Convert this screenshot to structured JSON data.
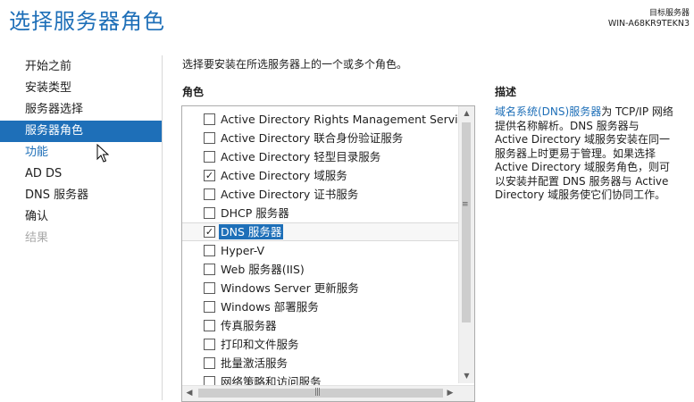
{
  "page": {
    "title": "选择服务器角色",
    "target_label": "目标服务器",
    "target_server": "WIN-A68KR9TEKN3",
    "instruction": "选择要安装在所选服务器上的一个或多个角色。",
    "roles_heading": "角色",
    "description_heading": "描述"
  },
  "nav": {
    "items": [
      {
        "label": "开始之前",
        "state": "normal"
      },
      {
        "label": "安装类型",
        "state": "normal"
      },
      {
        "label": "服务器选择",
        "state": "normal"
      },
      {
        "label": "服务器角色",
        "state": "current"
      },
      {
        "label": "功能",
        "state": "link"
      },
      {
        "label": "AD DS",
        "state": "normal"
      },
      {
        "label": "DNS 服务器",
        "state": "normal"
      },
      {
        "label": "确认",
        "state": "normal"
      },
      {
        "label": "结果",
        "state": "disabled"
      }
    ]
  },
  "roles": [
    {
      "label": "Active Directory Rights Management Services",
      "checked": false,
      "selected": false
    },
    {
      "label": "Active Directory 联合身份验证服务",
      "checked": false,
      "selected": false
    },
    {
      "label": "Active Directory 轻型目录服务",
      "checked": false,
      "selected": false
    },
    {
      "label": "Active Directory 域服务",
      "checked": true,
      "selected": false
    },
    {
      "label": "Active Directory 证书服务",
      "checked": false,
      "selected": false
    },
    {
      "label": "DHCP 服务器",
      "checked": false,
      "selected": false
    },
    {
      "label": "DNS 服务器",
      "checked": true,
      "selected": true
    },
    {
      "label": "Hyper-V",
      "checked": false,
      "selected": false
    },
    {
      "label": "Web 服务器(IIS)",
      "checked": false,
      "selected": false
    },
    {
      "label": "Windows Server 更新服务",
      "checked": false,
      "selected": false
    },
    {
      "label": "Windows 部署服务",
      "checked": false,
      "selected": false
    },
    {
      "label": "传真服务器",
      "checked": false,
      "selected": false
    },
    {
      "label": "打印和文件服务",
      "checked": false,
      "selected": false
    },
    {
      "label": "批量激活服务",
      "checked": false,
      "selected": false
    },
    {
      "label": "网络策略和访问服务",
      "checked": false,
      "selected": false
    }
  ],
  "description": {
    "link_text": "域名系统(DNS)服务器",
    "text": "为 TCP/IP 网络提供名称解析。DNS 服务器与 Active Directory 域服务安装在同一服务器上时更易于管理。如果选择 Active Directory 域服务角色，则可以安装并配置 DNS 服务器与 Active Directory 域服务使它们协同工作。"
  },
  "icons": {
    "check": "✓",
    "scroll_up": "▲",
    "scroll_down": "▼",
    "scroll_left": "◀",
    "scroll_right": "▶",
    "grip": "≡"
  },
  "colors": {
    "accent": "#1e6fb8",
    "disabled": "#a9a9a9"
  }
}
